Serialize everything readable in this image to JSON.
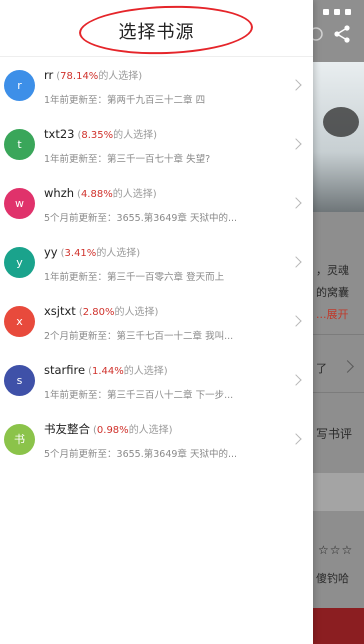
{
  "drawer": {
    "title": "选择书源",
    "sources": [
      {
        "avatar_letter": "r",
        "avatar_color": "#3d8fe8",
        "name": "rr",
        "percent": "78.14%",
        "suffix": "的人选择)",
        "prefix": "(",
        "update": "1年前更新至：第两千九百三十二章 四"
      },
      {
        "avatar_letter": "t",
        "avatar_color": "#3aa65a",
        "name": "txt23",
        "percent": "8.35%",
        "suffix": "的人选择)",
        "prefix": "(",
        "update": "1年前更新至：第三千一百七十章 失望?"
      },
      {
        "avatar_letter": "w",
        "avatar_color": "#e0326b",
        "name": "whzh",
        "percent": "4.88%",
        "suffix": "的人选择)",
        "prefix": "(",
        "update": "5个月前更新至：3655.第3649章 天狱中的..."
      },
      {
        "avatar_letter": "y",
        "avatar_color": "#1aa38c",
        "name": "yy",
        "percent": "3.41%",
        "suffix": "的人选择)",
        "prefix": "(",
        "update": "1年前更新至：第三千一百零六章 登天而上"
      },
      {
        "avatar_letter": "x",
        "avatar_color": "#e84a3c",
        "name": "xsjtxt",
        "percent": "2.80%",
        "suffix": "的人选择)",
        "prefix": "(",
        "update": "2个月前更新至：第三千七百一十二章 我叫..."
      },
      {
        "avatar_letter": "s",
        "avatar_color": "#3f51a8",
        "name": "starfire",
        "percent": "1.44%",
        "suffix": "的人选择)",
        "prefix": "(",
        "update": "1年前更新至：第三千三百八十二章 下一步..."
      },
      {
        "avatar_letter": "书",
        "avatar_color": "#8bc34a",
        "name": "书友整合",
        "percent": "0.98%",
        "suffix": "的人选择)",
        "prefix": "(",
        "update": "5个月前更新至：3655.第3649章 天狱中的..."
      }
    ]
  },
  "background": {
    "line1": "，灵魂",
    "line2": "的窝囊",
    "expand": "...展开",
    "row_text": "了",
    "review": "写书评",
    "stars": "☆☆☆",
    "bottom_text": "傻钓哈"
  }
}
